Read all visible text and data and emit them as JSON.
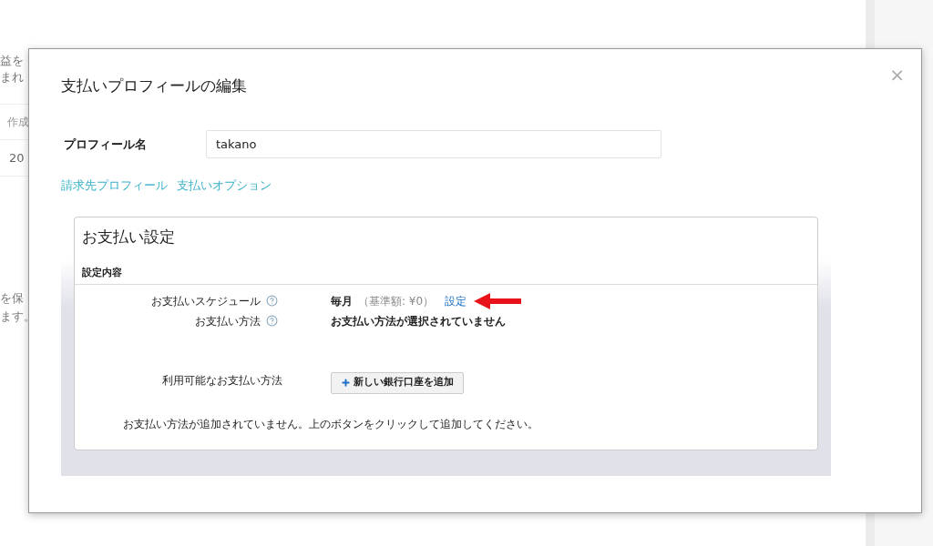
{
  "background_page": {
    "text_fragments": [
      "益を",
      "まれ"
    ],
    "table": {
      "column_1": "作成",
      "cell": "20"
    },
    "note_fragments": [
      "を保",
      "ます。"
    ]
  },
  "dialog": {
    "title": "支払いプロフィールの編集",
    "close": "×",
    "profile_name": {
      "label": "プロフィール名",
      "value": "takano"
    },
    "links": [
      "請求先プロフィール",
      "支払いオプション"
    ],
    "payment_settings": {
      "title": "お支払い設定",
      "section": "設定内容",
      "rows": [
        {
          "label": "お支払いスケジュール",
          "value": "毎月",
          "detail": "（基準額: ¥0）",
          "link": "設定",
          "highlighted": true
        },
        {
          "label": "お支払い方法",
          "value": "お支払い方法が選択されていません",
          "highlighted": false
        }
      ],
      "available": {
        "label": "利用可能なお支払い方法",
        "button": "新しい銀行口座を追加"
      },
      "message": "お支払い方法が追加されていません。上のボタンをクリックして追加してください。"
    }
  }
}
